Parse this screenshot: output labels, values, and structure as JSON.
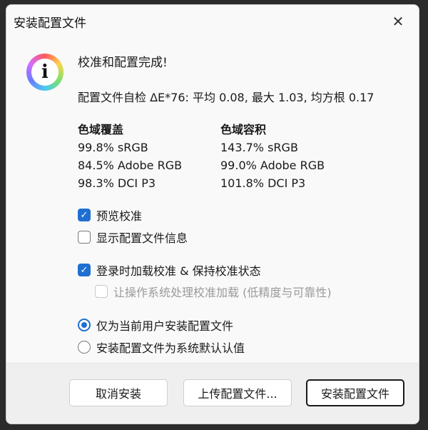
{
  "window": {
    "title": "安装配置文件",
    "close_glyph": "✕"
  },
  "message": {
    "icon": "info-icon",
    "icon_glyph": "i",
    "heading": "校准和配置完成!",
    "self_check": "配置文件自检 ΔE*76: 平均 0.08, 最大 1.03, 均方根 0.17"
  },
  "gamut_coverage": {
    "header": "色域覆盖",
    "rows": [
      "99.8% sRGB",
      "84.5% Adobe RGB",
      "98.3% DCI P3"
    ]
  },
  "gamut_volume": {
    "header": "色域容积",
    "rows": [
      "143.7% sRGB",
      "99.0% Adobe RGB",
      "101.8% DCI P3"
    ]
  },
  "options": {
    "preview_calibration": {
      "label": "预览校准",
      "checked": true
    },
    "show_profile_info": {
      "label": "显示配置文件信息",
      "checked": false
    },
    "load_on_login": {
      "label": "登录时加载校准 & 保持校准状态",
      "checked": true
    },
    "os_handles_loading": {
      "label": "让操作系统处理校准加载 (低精度与可靠性)",
      "checked": false,
      "disabled": true
    }
  },
  "scope": {
    "current_user": {
      "label": "仅为当前用户安装配置文件",
      "selected": true
    },
    "system_default": {
      "label": "安装配置文件为系统默认认值",
      "selected": false
    }
  },
  "buttons": {
    "cancel": "取消安装",
    "upload": "上传配置文件...",
    "install": "安装配置文件"
  },
  "colors": {
    "accent": "#1f6fd1"
  }
}
